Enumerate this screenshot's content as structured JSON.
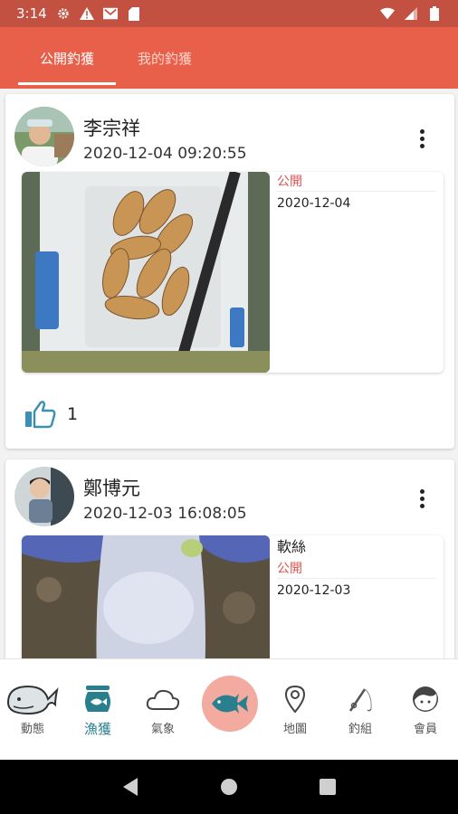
{
  "status_bar": {
    "time": "3:14",
    "left_icons": [
      "gear-icon",
      "warning-icon",
      "gmail-icon",
      "sd-card-icon"
    ],
    "right_icons": [
      "wifi-icon",
      "signal-icon",
      "battery-icon"
    ]
  },
  "tabs": [
    {
      "label": "公開釣獲",
      "active": true
    },
    {
      "label": "我的釣獲",
      "active": false
    }
  ],
  "posts": [
    {
      "author": "李宗祥",
      "datetime": "2020-12-04 09:20:55",
      "catch_title": "",
      "visibility": "公開",
      "date": "2020-12-04",
      "likes": "1"
    },
    {
      "author": "鄭博元",
      "datetime": "2020-12-03 16:08:05",
      "catch_title": "軟絲",
      "visibility": "公開",
      "date": "2020-12-03"
    }
  ],
  "bottom_nav": [
    {
      "label": "動態",
      "icon": "whale-icon",
      "active": false
    },
    {
      "label": "漁獲",
      "icon": "fish-bowl-icon",
      "active": true
    },
    {
      "label": "氣象",
      "icon": "cloud-icon",
      "active": false
    },
    {
      "label": "",
      "icon": "fish-icon",
      "active": false
    },
    {
      "label": "地圖",
      "icon": "map-pin-icon",
      "active": false
    },
    {
      "label": "釣組",
      "icon": "fishing-rod-icon",
      "active": false
    },
    {
      "label": "會員",
      "icon": "member-face-icon",
      "active": false
    }
  ],
  "colors": {
    "status_bar": "#c25142",
    "header": "#e8604a",
    "accent_teal": "#2a7f8f",
    "public_red": "#d9534f",
    "fab": "#f3aa9f",
    "like_blue": "#3a8fb7"
  }
}
